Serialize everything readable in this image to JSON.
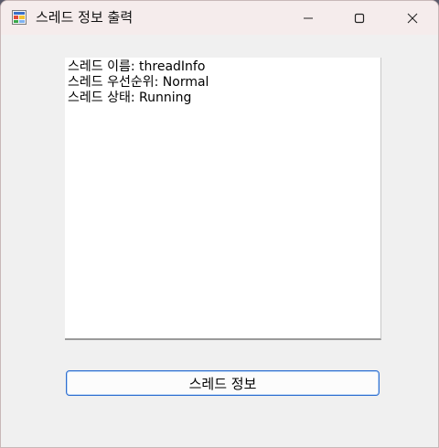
{
  "window": {
    "title": "스레드 정보 출력"
  },
  "textbox": {
    "lines": [
      "스레드 이름: threadInfo",
      "스레드 우선순위: Normal",
      "스레드 상태: Running"
    ]
  },
  "actions": {
    "thread_info_label": "스레드 정보"
  },
  "colors": {
    "titlebar": "#f5ecec",
    "client": "#f0f0f0",
    "accent_border": "#2f6fd0"
  }
}
